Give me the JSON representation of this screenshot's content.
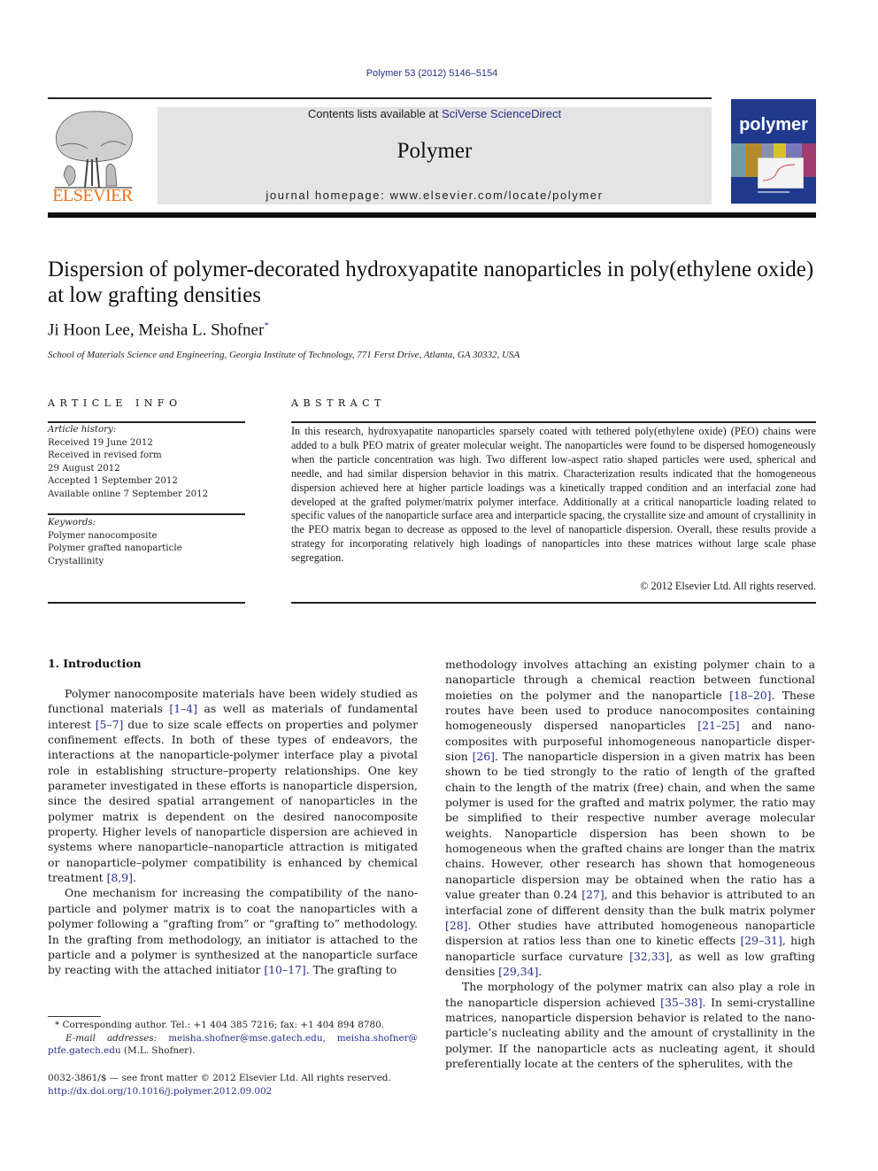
{
  "header": {
    "citation": "Polymer 53 (2012) 5146–5154",
    "contents_prefix": "Contents lists available at ",
    "contents_link": "SciVerse ScienceDirect",
    "journal_name": "Polymer",
    "homepage": "journal homepage: www.elsevier.com/locate/polymer",
    "publisher_logo_text": "ELSEVIER",
    "cover_title": "polymer",
    "colors": {
      "link": "#2a2f8a",
      "publisher_orange": "#e8731a",
      "band": "#e4e4e4",
      "cover_blue": "#1f3a8c"
    }
  },
  "article": {
    "title": "Dispersion of polymer-decorated hydroxyapatite nanoparticles in poly(ethylene oxide) at low grafting densities",
    "authors": "Ji Hoon Lee, Meisha L. Shofner",
    "author_mark": "*",
    "affiliation": "School of Materials Science and Engineering, Georgia Institute of Technology, 771 Ferst Drive, Atlanta, GA 30332, USA"
  },
  "article_info": {
    "heading": "ARTICLE INFO",
    "history_label": "Article history:",
    "history": [
      "Received 19 June 2012",
      "Received in revised form",
      "29 August 2012",
      "Accepted 1 September 2012",
      "Available online 7 September 2012"
    ],
    "keywords_label": "Keywords:",
    "keywords": [
      "Polymer nanocomposite",
      "Polymer grafted nanoparticle",
      "Crystallinity"
    ]
  },
  "abstract": {
    "heading": "ABSTRACT",
    "text": "In this research, hydroxyapatite nanoparticles sparsely coated with tethered poly(ethylene oxide) (PEO) chains were added to a bulk PEO matrix of greater molecular weight. The nanoparticles were found to be dispersed homogeneously when the particle concentration was high. Two different low-aspect ratio shaped particles were used, spherical and needle, and had similar dispersion behavior in this matrix. Characterization results indicated that the homogeneous dispersion achieved here at higher particle loadings was a kinetically trapped condition and an interfacial zone had developed at the grafted polymer/matrix polymer interface. Additionally at a critical nanoparticle loading related to specific values of the nanoparticle surface area and interparticle spacing, the crystallite size and amount of crystallinity in the PEO matrix began to decrease as opposed to the level of nanoparticle dispersion. Overall, these results provide a strategy for incorporating relatively high loadings of nanoparticles into these matrices without large scale phase segregation.",
    "copyright": "© 2012 Elsevier Ltd. All rights reserved."
  },
  "body": {
    "intro_heading": "1.  Introduction",
    "left_paragraphs": [
      [
        {
          "t": "Polymer nanocomposite materials have been widely studied as functional materials "
        },
        {
          "ref": "[1–4]"
        },
        {
          "t": " as well as materials of fundamental interest "
        },
        {
          "ref": "[5–7]"
        },
        {
          "t": " due to size scale effects on properties and polymer confinement effects. In both of these types of endeavors, the interactions at the nanoparticle-polymer interface play a pivotal role in establishing structure–property relationships. One key parameter investigated in these efforts is nanoparticle dispersion, since the desired spatial arrangement of nanoparticles in the polymer matrix is dependent on the desired nanocomposite property. Higher levels of nanoparticle dispersion are achieved in systems where nanoparticle–nanoparticle attraction is mitigated or nanoparticle–polymer compatibility is enhanced by chemical treatment "
        },
        {
          "ref": "[8,9]"
        },
        {
          "t": "."
        }
      ],
      [
        {
          "t": "One mechanism for increasing the compatibility of the nano­particle and polymer matrix is to coat the nanoparticles with a polymer following a “grafting from” or “grafting to” methodology. In the grafting from methodology, an initiator is attached to the particle and a polymer is synthesized at the nanoparticle surface by reacting with the attached initiator "
        },
        {
          "ref": "[10–17]"
        },
        {
          "t": ". The grafting to"
        }
      ]
    ],
    "right_paragraphs": [
      [
        {
          "t": "methodology involves attaching an existing polymer chain to a nanoparticle through a chemical reaction between functional moieties on the polymer and the nanoparticle "
        },
        {
          "ref": "[18–20]"
        },
        {
          "t": ". These routes have been used to produce nanocomposites containing homogeneously dispersed nanoparticles "
        },
        {
          "ref": "[21–25]"
        },
        {
          "t": " and nano­composites with purposeful inhomogeneous nanoparticle disper­sion "
        },
        {
          "ref": "[26]"
        },
        {
          "t": ". The nanoparticle dispersion in a given matrix has been shown to be tied strongly to the ratio of length of the grafted chain to the length of the matrix (free) chain, and when the same poly­mer is used for the grafted and matrix polymer, the ratio may be simplified to their respective number average molecular weights. Nanoparticle dispersion has been shown to be homogeneous when the grafted chains are longer than the matrix chains. However, other research has shown that homogeneous nanoparticle disper­sion may be obtained when the ratio has a value greater than 0.24 "
        },
        {
          "ref": "[27]"
        },
        {
          "t": ", and this behavior is attributed to an interfacial zone of different density than the bulk matrix polymer "
        },
        {
          "ref": "[28]"
        },
        {
          "t": ". Other studies have attributed homogeneous nanoparticle dispersion at ratios less than one to kinetic effects "
        },
        {
          "ref": "[29–31]"
        },
        {
          "t": ", high nanoparticle surface curvature "
        },
        {
          "ref": "[32,33]"
        },
        {
          "t": ", as well as low grafting densities "
        },
        {
          "ref": "[29,34]"
        },
        {
          "t": "."
        }
      ],
      [
        {
          "t": "The morphology of the polymer matrix can also play a role in the nanoparticle dispersion achieved "
        },
        {
          "ref": "[35–38]"
        },
        {
          "t": ". In semi-crystalline matrices, nanoparticle dispersion behavior is related to the nano­particle’s nucleating ability and the amount of crystallinity in the polymer. If the nanoparticle acts as nucleating agent, it should preferentially locate at the centers of the spherulites, with the"
        }
      ]
    ]
  },
  "footnote": {
    "mark": "*",
    "corresponding": "Corresponding author. Tel.: +1 404 385 7216; fax: +1 404 894 8780.",
    "email_label_1": "E-mail",
    "email_label_2": "addresses:",
    "email_1": "meisha.shofner@mse.gatech.edu,",
    "email_2a": "meisha.shofner@",
    "email_2b": "ptfe.gatech.edu",
    "email_owner": " (M.L. Shofner)."
  },
  "front_matter": {
    "issn_line": "0032-3861/$ — see front matter © 2012 Elsevier Ltd. All rights reserved.",
    "doi": "http://dx.doi.org/10.1016/j.polymer.2012.09.002"
  }
}
